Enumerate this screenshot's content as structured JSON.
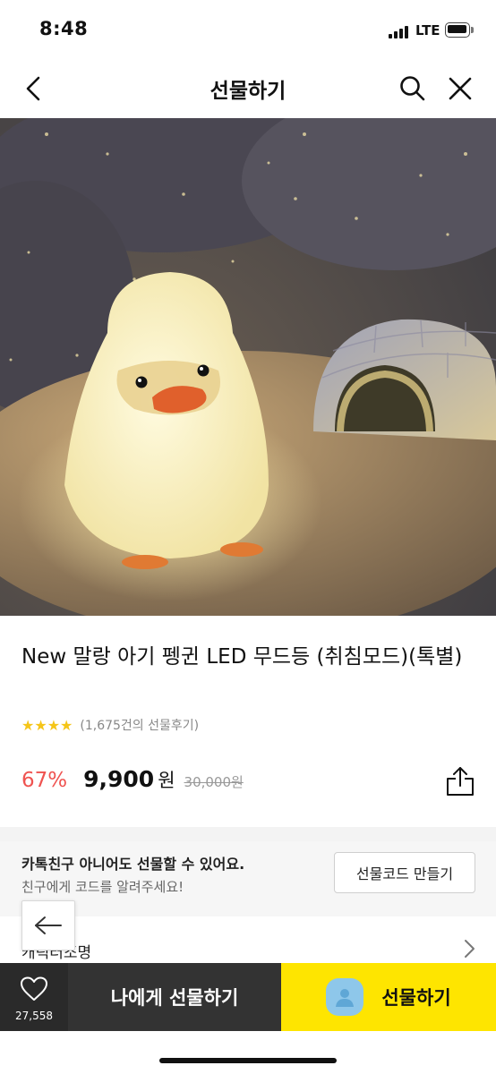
{
  "status": {
    "time": "8:48",
    "network": "LTE"
  },
  "nav": {
    "title": "선물하기"
  },
  "product": {
    "title": "New 말랑 아기 펭귄 LED 무드등 (취침모드)(톡별)",
    "stars": "★★★★",
    "review_count": "(1,675건의 선물후기)",
    "discount": "67%",
    "price": "9,900",
    "currency": "원",
    "original_price": "30,000원"
  },
  "gift_code": {
    "title": "카톡친구 아니어도 선물할 수 있어요.",
    "subtitle": "친구에게 코드를 알려주세요!",
    "button": "선물코드 만들기"
  },
  "category": {
    "label": "캐릭터조명"
  },
  "bottom": {
    "wish_count": "27,558",
    "self_gift": "나에게 선물하기",
    "gift": "선물하기"
  },
  "colors": {
    "discount": "#ef5350",
    "star": "#f5c518",
    "gift_button": "#fee500",
    "dark_button": "#333333"
  },
  "icons": [
    "back-icon",
    "search-icon",
    "close-icon",
    "share-icon",
    "heart-icon",
    "chevron-right-icon",
    "arrow-left-icon",
    "friend-avatar-icon"
  ]
}
